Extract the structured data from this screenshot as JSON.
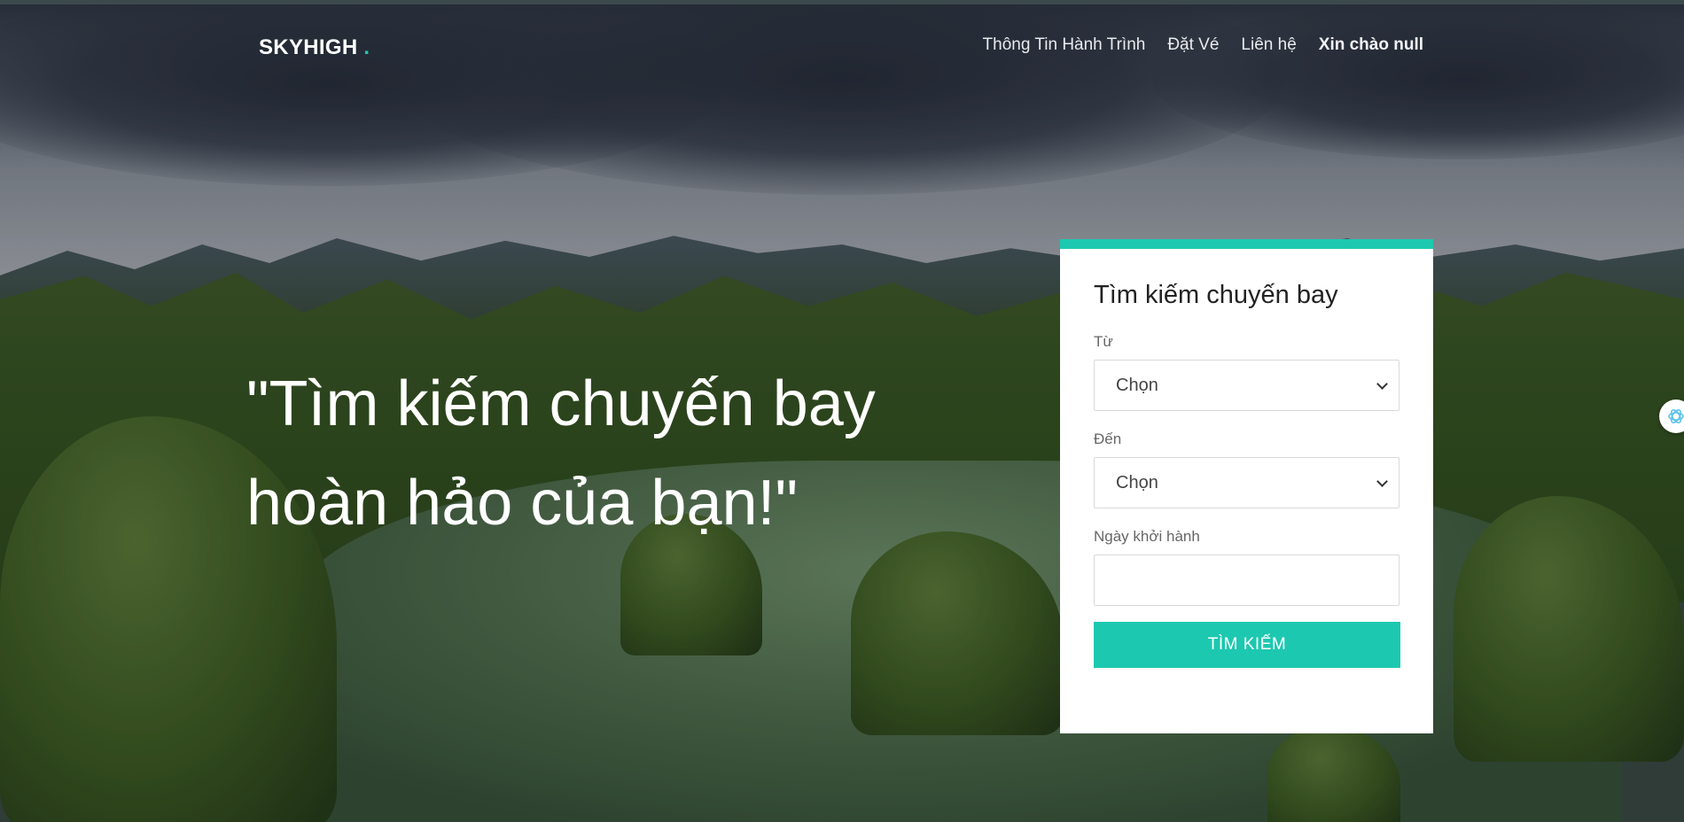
{
  "brand": {
    "name": "SKYHIGH",
    "dot": "."
  },
  "nav": {
    "items": [
      {
        "label": "Thông Tin Hành Trình"
      },
      {
        "label": "Đặt Vé"
      },
      {
        "label": "Liên hệ"
      },
      {
        "label": "Xin chào null"
      }
    ]
  },
  "hero": {
    "line1": "\"Tìm kiếm chuyến bay",
    "line2": "hoàn hảo của bạn!\""
  },
  "search_card": {
    "title": "Tìm kiếm chuyến bay",
    "from_label": "Từ",
    "from_value": "Chọn",
    "to_label": "Đến",
    "to_value": "Chọn",
    "date_label": "Ngày khởi hành",
    "date_value": "",
    "button_label": "TÌM KIẾM"
  },
  "colors": {
    "accent": "#1dc8b0",
    "card_bg": "#ffffff",
    "nav_text": "#e8eaed"
  },
  "icons": {
    "side_widget": "openai-swirl-icon"
  }
}
